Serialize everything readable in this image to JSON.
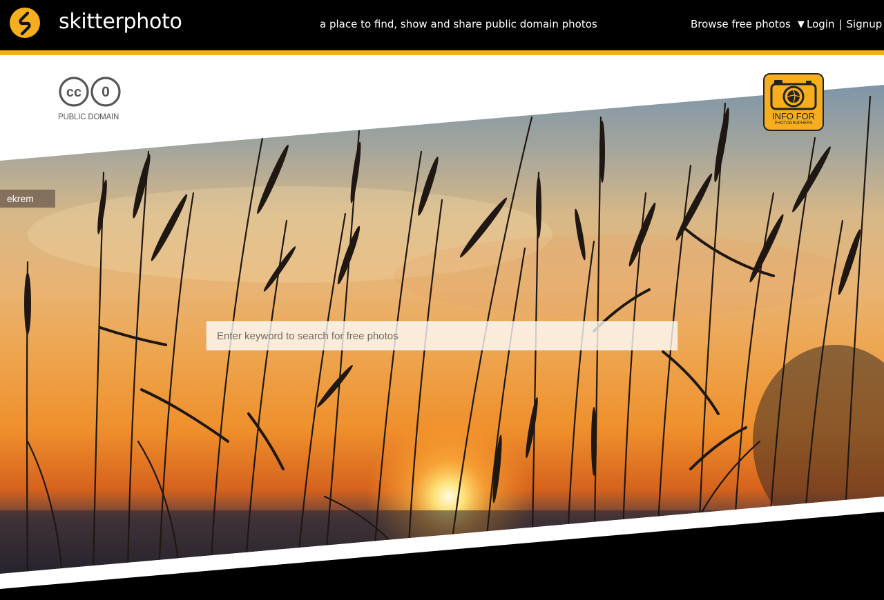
{
  "header": {
    "brand": "skitterphoto",
    "tagline": "a place to find, show and share public domain photos",
    "browse_label": "Browse free photos",
    "login_label": "Login",
    "separator": "|",
    "signup_label": "Signup"
  },
  "license": {
    "cc_text": "cc",
    "zero_text": "0",
    "caption": "PUBLIC DOMAIN"
  },
  "info_badge": {
    "line1": "INFO FOR",
    "line2": "PHOTOGRAPHERS"
  },
  "photo_credit": "ekrem",
  "search": {
    "placeholder": "Enter keyword to search for free photos",
    "value": ""
  },
  "colors": {
    "accent": "#f6ae1e",
    "header_bg": "#000000"
  },
  "icons": {
    "logo": "skitterphoto-logo-icon",
    "browse_caret": "caret-down-icon",
    "camera": "camera-icon"
  }
}
